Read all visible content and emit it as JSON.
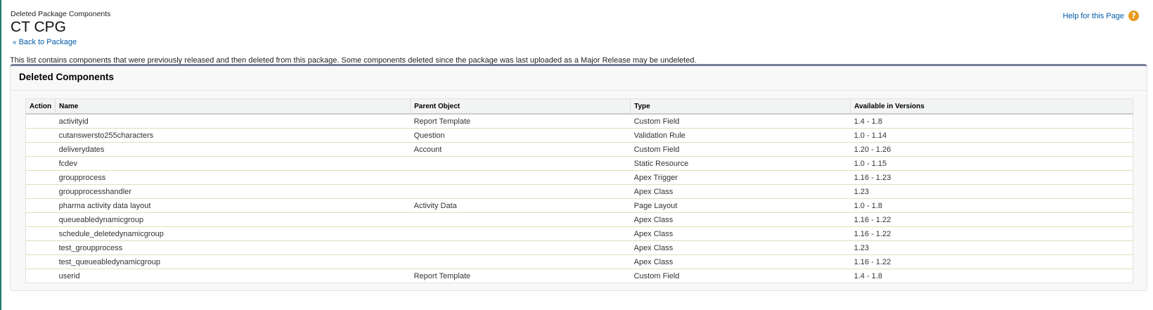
{
  "header": {
    "eyebrow": "Deleted Package Components",
    "title": "CT CPG",
    "back_link": "Back to Package",
    "back_glyph": "«",
    "help_link": "Help for this Page",
    "help_icon": "?"
  },
  "description": "This list contains components that were previously released and then deleted from this package. Some components deleted since the package was last uploaded as a Major Release may be undeleted.",
  "panel": {
    "title": "Deleted Components",
    "columns": [
      "Action",
      "Name",
      "Parent Object",
      "Type",
      "Available in Versions"
    ],
    "rows": [
      {
        "action": "",
        "name": "activityid",
        "parent": "Report Template",
        "type": "Custom Field",
        "versions": "1.4 - 1.8"
      },
      {
        "action": "",
        "name": "cutanswersto255characters",
        "parent": "Question",
        "type": "Validation Rule",
        "versions": "1.0 - 1.14"
      },
      {
        "action": "",
        "name": "deliverydates",
        "parent": "Account",
        "type": "Custom Field",
        "versions": "1.20 - 1.26"
      },
      {
        "action": "",
        "name": "fcdev",
        "parent": "",
        "type": "Static Resource",
        "versions": "1.0 - 1.15"
      },
      {
        "action": "",
        "name": "groupprocess",
        "parent": "",
        "type": "Apex Trigger",
        "versions": "1.16 - 1.23"
      },
      {
        "action": "",
        "name": "groupprocesshandler",
        "parent": "",
        "type": "Apex Class",
        "versions": "1.23"
      },
      {
        "action": "",
        "name": "pharma activity data layout",
        "parent": "Activity Data",
        "type": "Page Layout",
        "versions": "1.0 - 1.8"
      },
      {
        "action": "",
        "name": "queueabledynamicgroup",
        "parent": "",
        "type": "Apex Class",
        "versions": "1.16 - 1.22"
      },
      {
        "action": "",
        "name": "schedule_deletedynamicgroup",
        "parent": "",
        "type": "Apex Class",
        "versions": "1.16 - 1.22"
      },
      {
        "action": "",
        "name": "test_groupprocess",
        "parent": "",
        "type": "Apex Class",
        "versions": "1.23"
      },
      {
        "action": "",
        "name": "test_queueabledynamicgroup",
        "parent": "",
        "type": "Apex Class",
        "versions": "1.16 - 1.22"
      },
      {
        "action": "",
        "name": "userid",
        "parent": "Report Template",
        "type": "Custom Field",
        "versions": "1.4 - 1.8"
      }
    ]
  },
  "colors": {
    "link": "#015ba7",
    "help_icon": "#e69a1c",
    "panel_accent": "#747e96",
    "row_border": "#e3deb8"
  }
}
